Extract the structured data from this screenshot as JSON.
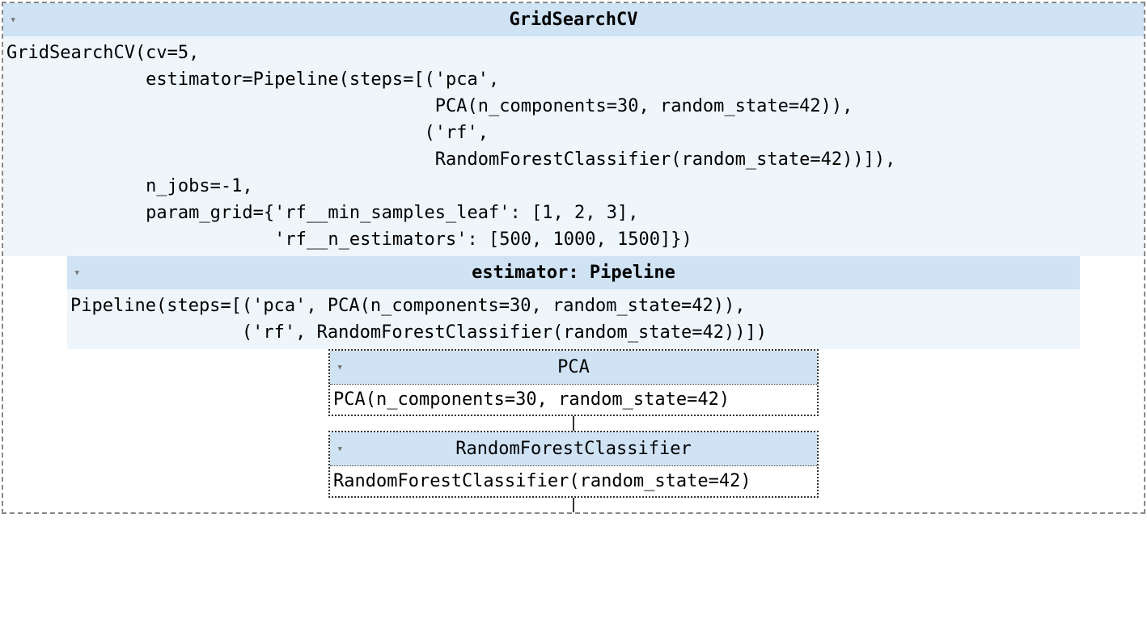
{
  "top": {
    "title": "GridSearchCV",
    "code": "GridSearchCV(cv=5,\n             estimator=Pipeline(steps=[('pca',\n                                        PCA(n_components=30, random_state=42)),\n                                       ('rf',\n                                        RandomForestClassifier(random_state=42))]),\n             n_jobs=-1,\n             param_grid={'rf__min_samples_leaf': [1, 2, 3],\n                         'rf__n_estimators': [500, 1000, 1500]})"
  },
  "estimator": {
    "title": "estimator: Pipeline",
    "code": "Pipeline(steps=[('pca', PCA(n_components=30, random_state=42)),\n                ('rf', RandomForestClassifier(random_state=42))])"
  },
  "step1": {
    "title": "PCA",
    "code": "PCA(n_components=30, random_state=42)"
  },
  "step2": {
    "title": "RandomForestClassifier",
    "code": "RandomForestClassifier(random_state=42)"
  },
  "glyphs": {
    "triangle": "▾"
  }
}
